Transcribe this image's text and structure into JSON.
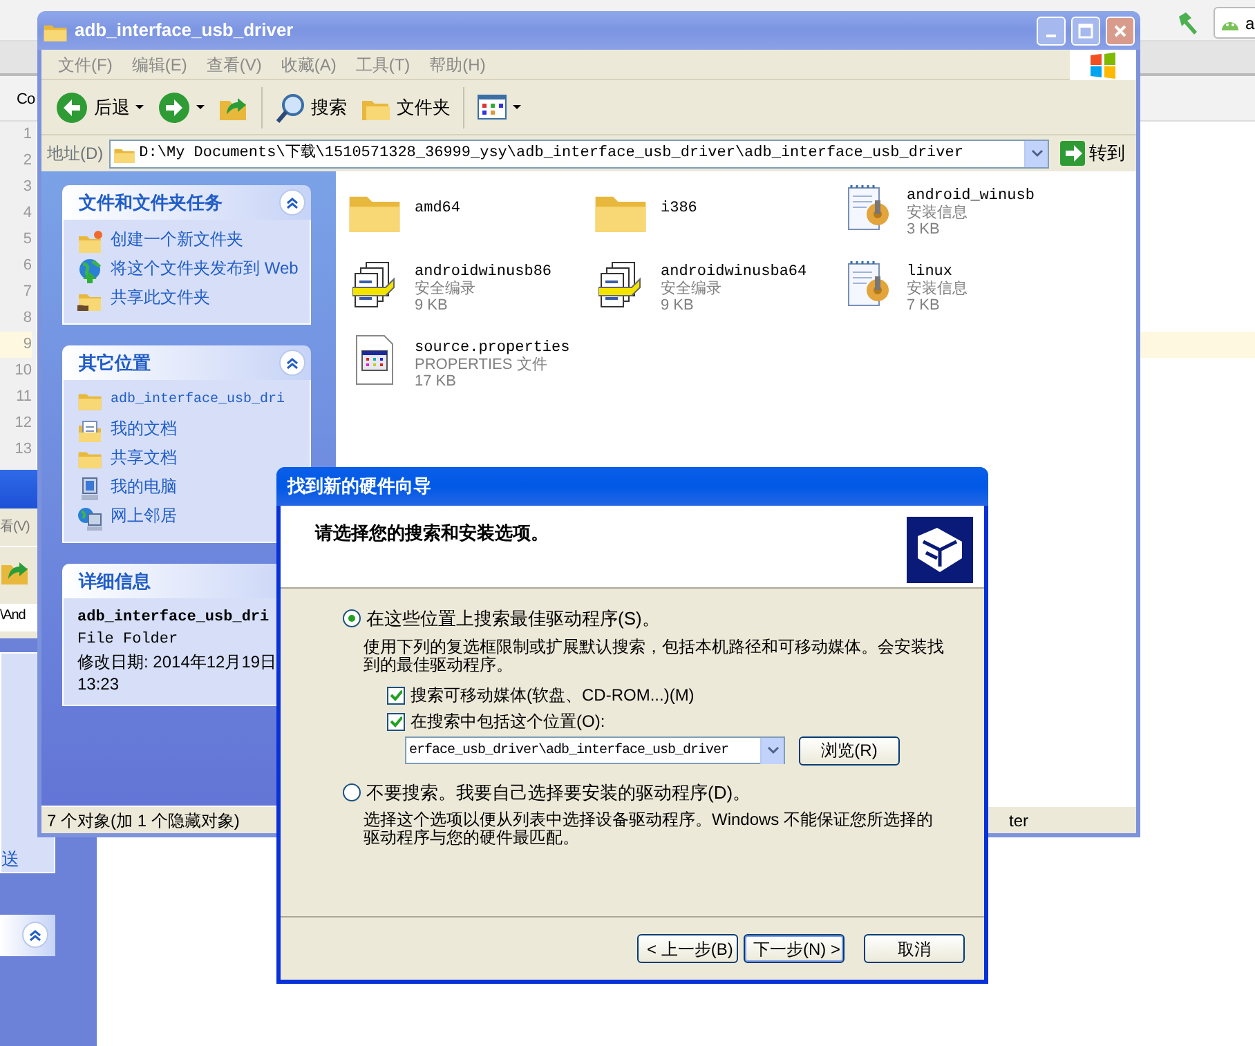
{
  "ide": {
    "run_config": "a",
    "tab_label": "Co",
    "lines": [
      {
        "number": "1",
        "current": false
      },
      {
        "number": "2",
        "current": false
      },
      {
        "number": "3",
        "current": false
      },
      {
        "number": "4",
        "current": false
      },
      {
        "number": "5",
        "current": false
      },
      {
        "number": "6",
        "current": false
      },
      {
        "number": "7",
        "current": false
      },
      {
        "number": "8",
        "current": false
      },
      {
        "number": "9",
        "current": true
      },
      {
        "number": "10",
        "current": false
      },
      {
        "number": "11",
        "current": false
      },
      {
        "number": "12",
        "current": false
      },
      {
        "number": "13",
        "current": false
      }
    ]
  },
  "back_window": {
    "menu_fragment": "看(V)",
    "address_fragment": "\\And",
    "link_fragment": "送"
  },
  "explorer": {
    "title": "adb_interface_usb_driver",
    "menu": [
      "文件(F)",
      "编辑(E)",
      "查看(V)",
      "收藏(A)",
      "工具(T)",
      "帮助(H)"
    ],
    "toolbar": [
      {
        "kind": "back",
        "label": "后退"
      },
      {
        "kind": "forward"
      },
      {
        "kind": "up"
      },
      {
        "kind": "search",
        "label": "搜索"
      },
      {
        "kind": "folders",
        "label": "文件夹"
      },
      {
        "kind": "views"
      }
    ],
    "address": {
      "label": "地址(D)",
      "value": "D:\\My Documents\\下载\\1510571328_36999_ysy\\adb_interface_usb_driver\\adb_interface_usb_driver",
      "go": "转到"
    },
    "panels": [
      {
        "title": "文件和文件夹任务",
        "expanded": true,
        "items": [
          {
            "kind": "new-folder",
            "label": "创建一个新文件夹"
          },
          {
            "kind": "publish",
            "label": "将这个文件夹发布到 Web"
          },
          {
            "kind": "share",
            "label": "共享此文件夹"
          }
        ]
      },
      {
        "title": "其它位置",
        "expanded": true,
        "items": [
          {
            "kind": "folder",
            "label": "adb_interface_usb_dri"
          },
          {
            "kind": "documents",
            "label": "我的文档"
          },
          {
            "kind": "folder",
            "label": "共享文档"
          },
          {
            "kind": "computer",
            "label": "我的电脑"
          },
          {
            "kind": "network",
            "label": "网上邻居"
          }
        ]
      }
    ],
    "details": {
      "title": "详细信息",
      "name": "adb_interface_usb_dri",
      "type": "File Folder",
      "modified": "修改日期: 2014年12月19日",
      "time": "13:23"
    },
    "files": [
      {
        "kind": "folder",
        "name": "amd64"
      },
      {
        "kind": "folder",
        "name": "i386"
      },
      {
        "kind": "inf",
        "name": "android_winusb",
        "type": "安装信息",
        "size": "3 KB"
      },
      {
        "kind": "catalog",
        "name": "androidwinusb86",
        "type": "安全编录",
        "size": "9 KB"
      },
      {
        "kind": "catalog",
        "name": "androidwinusba64",
        "type": "安全编录",
        "size": "9 KB"
      },
      {
        "kind": "inf",
        "name": "linux",
        "type": "安装信息",
        "size": "7 KB"
      },
      {
        "kind": "properties",
        "name": "source.properties",
        "type": "PROPERTIES 文件",
        "size": "17 KB"
      }
    ],
    "status": "7 个对象(加 1 个隐藏对象)",
    "status_right": "ter"
  },
  "dialog": {
    "title": "找到新的硬件向导",
    "heading": "请选择您的搜索和安装选项。",
    "options": [
      {
        "label": "在这些位置上搜索最佳驱动程序(S)。",
        "selected": true,
        "description": "使用下列的复选框限制或扩展默认搜索，包括本机路径和可移动媒体。会安装找到的最佳驱动程序。"
      },
      {
        "label": "不要搜索。我要自己选择要安装的驱动程序(D)。",
        "selected": false,
        "description": "选择这个选项以便从列表中选择设备驱动程序。Windows 不能保证您所选择的驱动程序与您的硬件最匹配。"
      }
    ],
    "checks": [
      {
        "label": "搜索可移动媒体(软盘、CD-ROM...)(M)",
        "checked": true
      },
      {
        "label": "在搜索中包括这个位置(O):",
        "checked": true
      }
    ],
    "location": "erface_usb_driver\\adb_interface_usb_driver",
    "browse": "浏览(R)",
    "buttons": [
      {
        "label": "< 上一步(B)",
        "default": false
      },
      {
        "label": "下一步(N) >",
        "default": true
      },
      {
        "label": "取消",
        "default": false
      }
    ]
  }
}
